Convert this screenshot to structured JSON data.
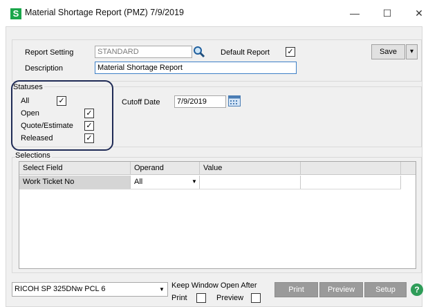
{
  "window": {
    "title": "Material Shortage Report (PMZ) 7/9/2019",
    "app_icon_letter": "S",
    "minimize": "—",
    "maximize": "☐",
    "close": "✕"
  },
  "header": {
    "report_setting_label": "Report Setting",
    "report_setting_value": "STANDARD",
    "default_report_label": "Default Report",
    "default_report_checked": "✓",
    "description_label": "Description",
    "description_value": "Material Shortage Report",
    "save_label": "Save",
    "save_dropdown": "▾"
  },
  "statuses": {
    "legend": "Statuses",
    "items": [
      {
        "label": "All",
        "check": "✓"
      },
      {
        "label": "Open",
        "check": "✓"
      },
      {
        "label": "Quote/Estimate",
        "check": "✓"
      },
      {
        "label": "Released",
        "check": "✓"
      }
    ]
  },
  "cutoff": {
    "label": "Cutoff Date",
    "value": "7/9/2019"
  },
  "selections": {
    "legend": "Selections",
    "columns": [
      "Select Field",
      "Operand",
      "Value",
      ""
    ],
    "rows": [
      {
        "select_field": "Work Ticket No",
        "operand": "All",
        "value": ""
      }
    ]
  },
  "footer": {
    "printer": "RICOH SP 325DNw PCL 6",
    "keep_open_label": "Keep Window Open After",
    "print_label": "Print",
    "preview_label": "Preview",
    "btn_print": "Print",
    "btn_preview": "Preview",
    "btn_setup": "Setup",
    "help": "?"
  },
  "colors": {
    "app_icon": "#1aa64a",
    "callout_border": "#1e2a55",
    "help_icon": "#2e9c58",
    "description_border": "#3c7fc6"
  }
}
